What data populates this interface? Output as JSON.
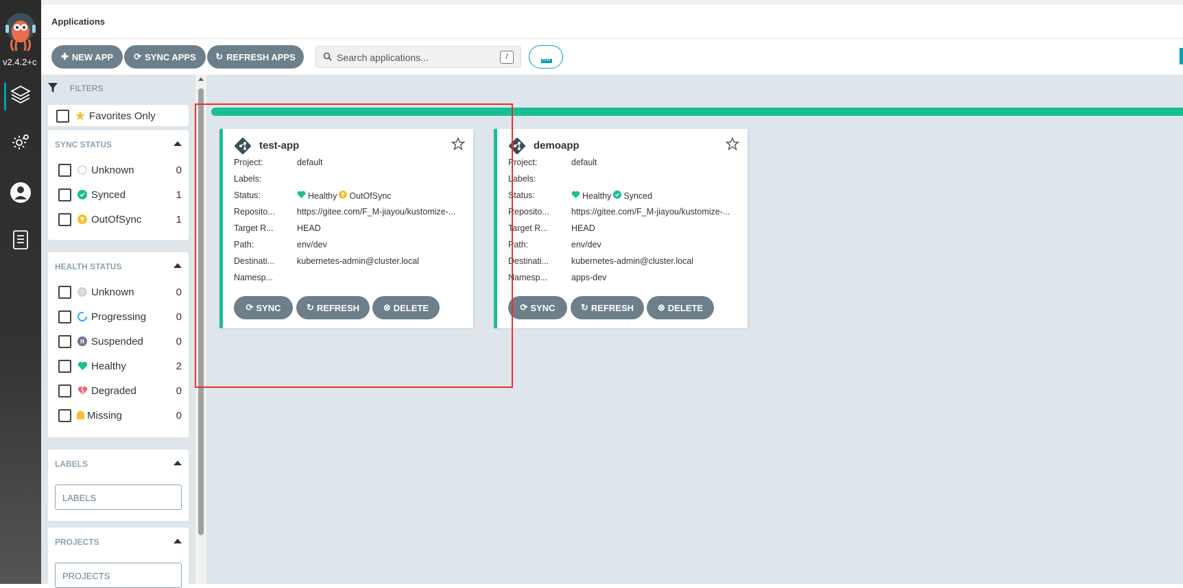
{
  "nav": {
    "version": "v2.4.2+c",
    "items": [
      "applications-icon",
      "settings-icon",
      "user-icon",
      "docs-icon"
    ]
  },
  "topbar": {
    "title": "Applications"
  },
  "toolbar": {
    "new_app": "NEW APP",
    "sync_apps": "SYNC APPS",
    "refresh_apps": "REFRESH APPS",
    "search_placeholder": "Search applications...",
    "search_shortcut": "/"
  },
  "filters": {
    "title": "FILTERS",
    "favorites": "Favorites Only",
    "sync_status": {
      "title": "SYNC STATUS",
      "items": [
        {
          "label": "Unknown",
          "count": "0"
        },
        {
          "label": "Synced",
          "count": "1"
        },
        {
          "label": "OutOfSync",
          "count": "1"
        }
      ]
    },
    "health_status": {
      "title": "HEALTH STATUS",
      "items": [
        {
          "label": "Unknown",
          "count": "0"
        },
        {
          "label": "Progressing",
          "count": "0"
        },
        {
          "label": "Suspended",
          "count": "0"
        },
        {
          "label": "Healthy",
          "count": "2"
        },
        {
          "label": "Degraded",
          "count": "0"
        },
        {
          "label": "Missing",
          "count": "0"
        }
      ]
    },
    "labels": {
      "title": "LABELS",
      "placeholder": "LABELS"
    },
    "projects": {
      "title": "PROJECTS",
      "placeholder": "PROJECTS"
    }
  },
  "field_labels": {
    "project": "Project:",
    "labels": "Labels:",
    "status": "Status:",
    "repository": "Reposito...",
    "target": "Target R...",
    "path": "Path:",
    "destination": "Destinati...",
    "namespace": "Namesp..."
  },
  "apps": [
    {
      "name": "test-app",
      "project": "default",
      "labels": "",
      "health": "Healthy",
      "sync": "OutOfSync",
      "repository": "https://gitee.com/F_M-jiayou/kustomize-...",
      "target": "HEAD",
      "path": "env/dev",
      "destination": "kubernetes-admin@cluster.local",
      "namespace": ""
    },
    {
      "name": "demoapp",
      "project": "default",
      "labels": "",
      "health": "Healthy",
      "sync": "Synced",
      "repository": "https://gitee.com/F_M-jiayou/kustomize-...",
      "target": "HEAD",
      "path": "env/dev",
      "destination": "kubernetes-admin@cluster.local",
      "namespace": "apps-dev"
    }
  ],
  "card_buttons": {
    "sync": "SYNC",
    "refresh": "REFRESH",
    "delete": "DELETE"
  },
  "colors": {
    "accent": "#00a2b3",
    "healthy": "#18be94",
    "outofsync": "#f4c030",
    "button": "#6d7f8b",
    "highlight": "#e8302a"
  }
}
